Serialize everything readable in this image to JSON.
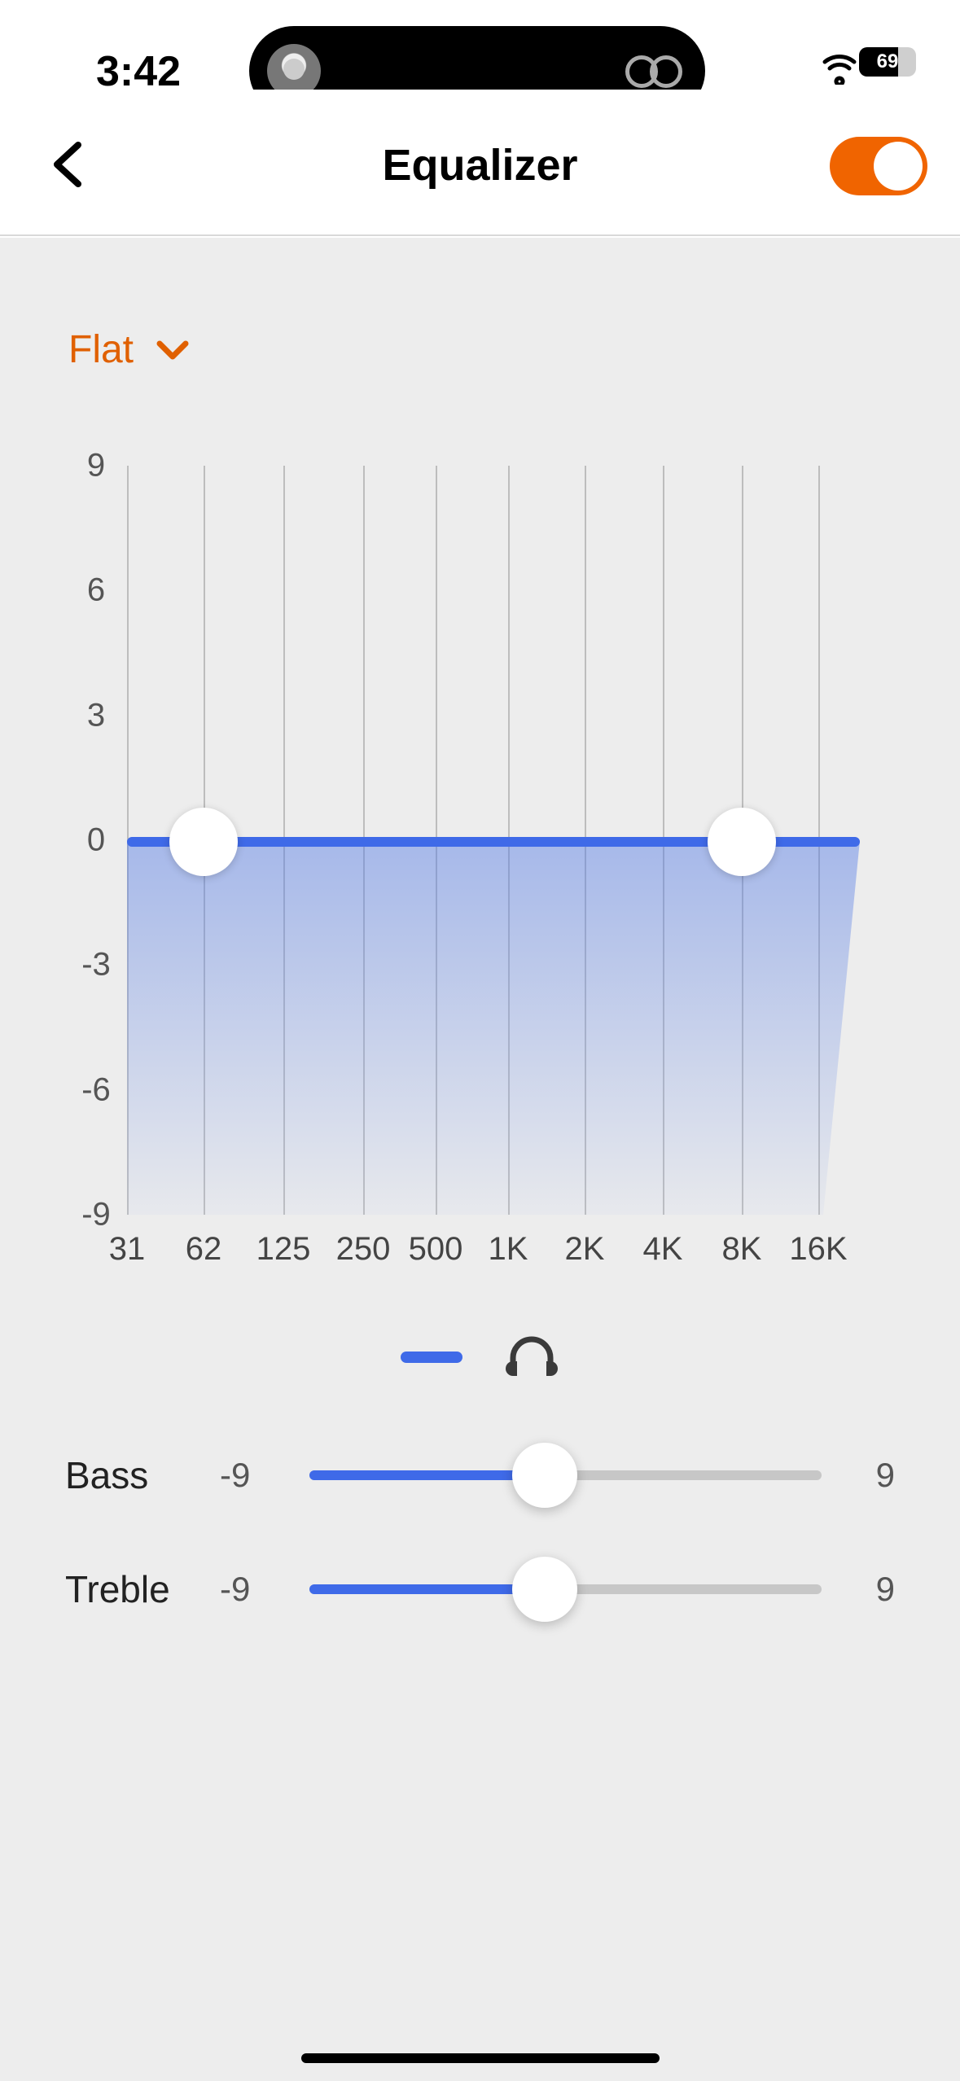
{
  "status": {
    "time": "3:42",
    "battery": "69"
  },
  "header": {
    "title": "Equalizer",
    "enabled": true
  },
  "preset": {
    "name": "Flat"
  },
  "chart_data": {
    "type": "line",
    "title": "Equalizer",
    "xlabel": "",
    "ylabel": "",
    "ylim": [
      -9,
      9
    ],
    "y_ticks": [
      9,
      6,
      3,
      0,
      -3,
      -6,
      -9
    ],
    "x_ticks": [
      "31",
      "62",
      "125",
      "250",
      "500",
      "1K",
      "2K",
      "4K",
      "8K",
      "16K"
    ],
    "categories": [
      "31",
      "62",
      "125",
      "250",
      "500",
      "1K",
      "2K",
      "4K",
      "8K",
      "16K"
    ],
    "values": [
      0,
      0,
      0,
      0,
      0,
      0,
      0,
      0,
      0,
      0
    ],
    "handles": [
      {
        "band": "62",
        "value": 0
      },
      {
        "band": "8K",
        "value": 0
      }
    ]
  },
  "sliders": {
    "bass": {
      "label": "Bass",
      "min": "-9",
      "max": "9",
      "value": 0
    },
    "treble": {
      "label": "Treble",
      "min": "-9",
      "max": "9",
      "value": 0
    }
  }
}
